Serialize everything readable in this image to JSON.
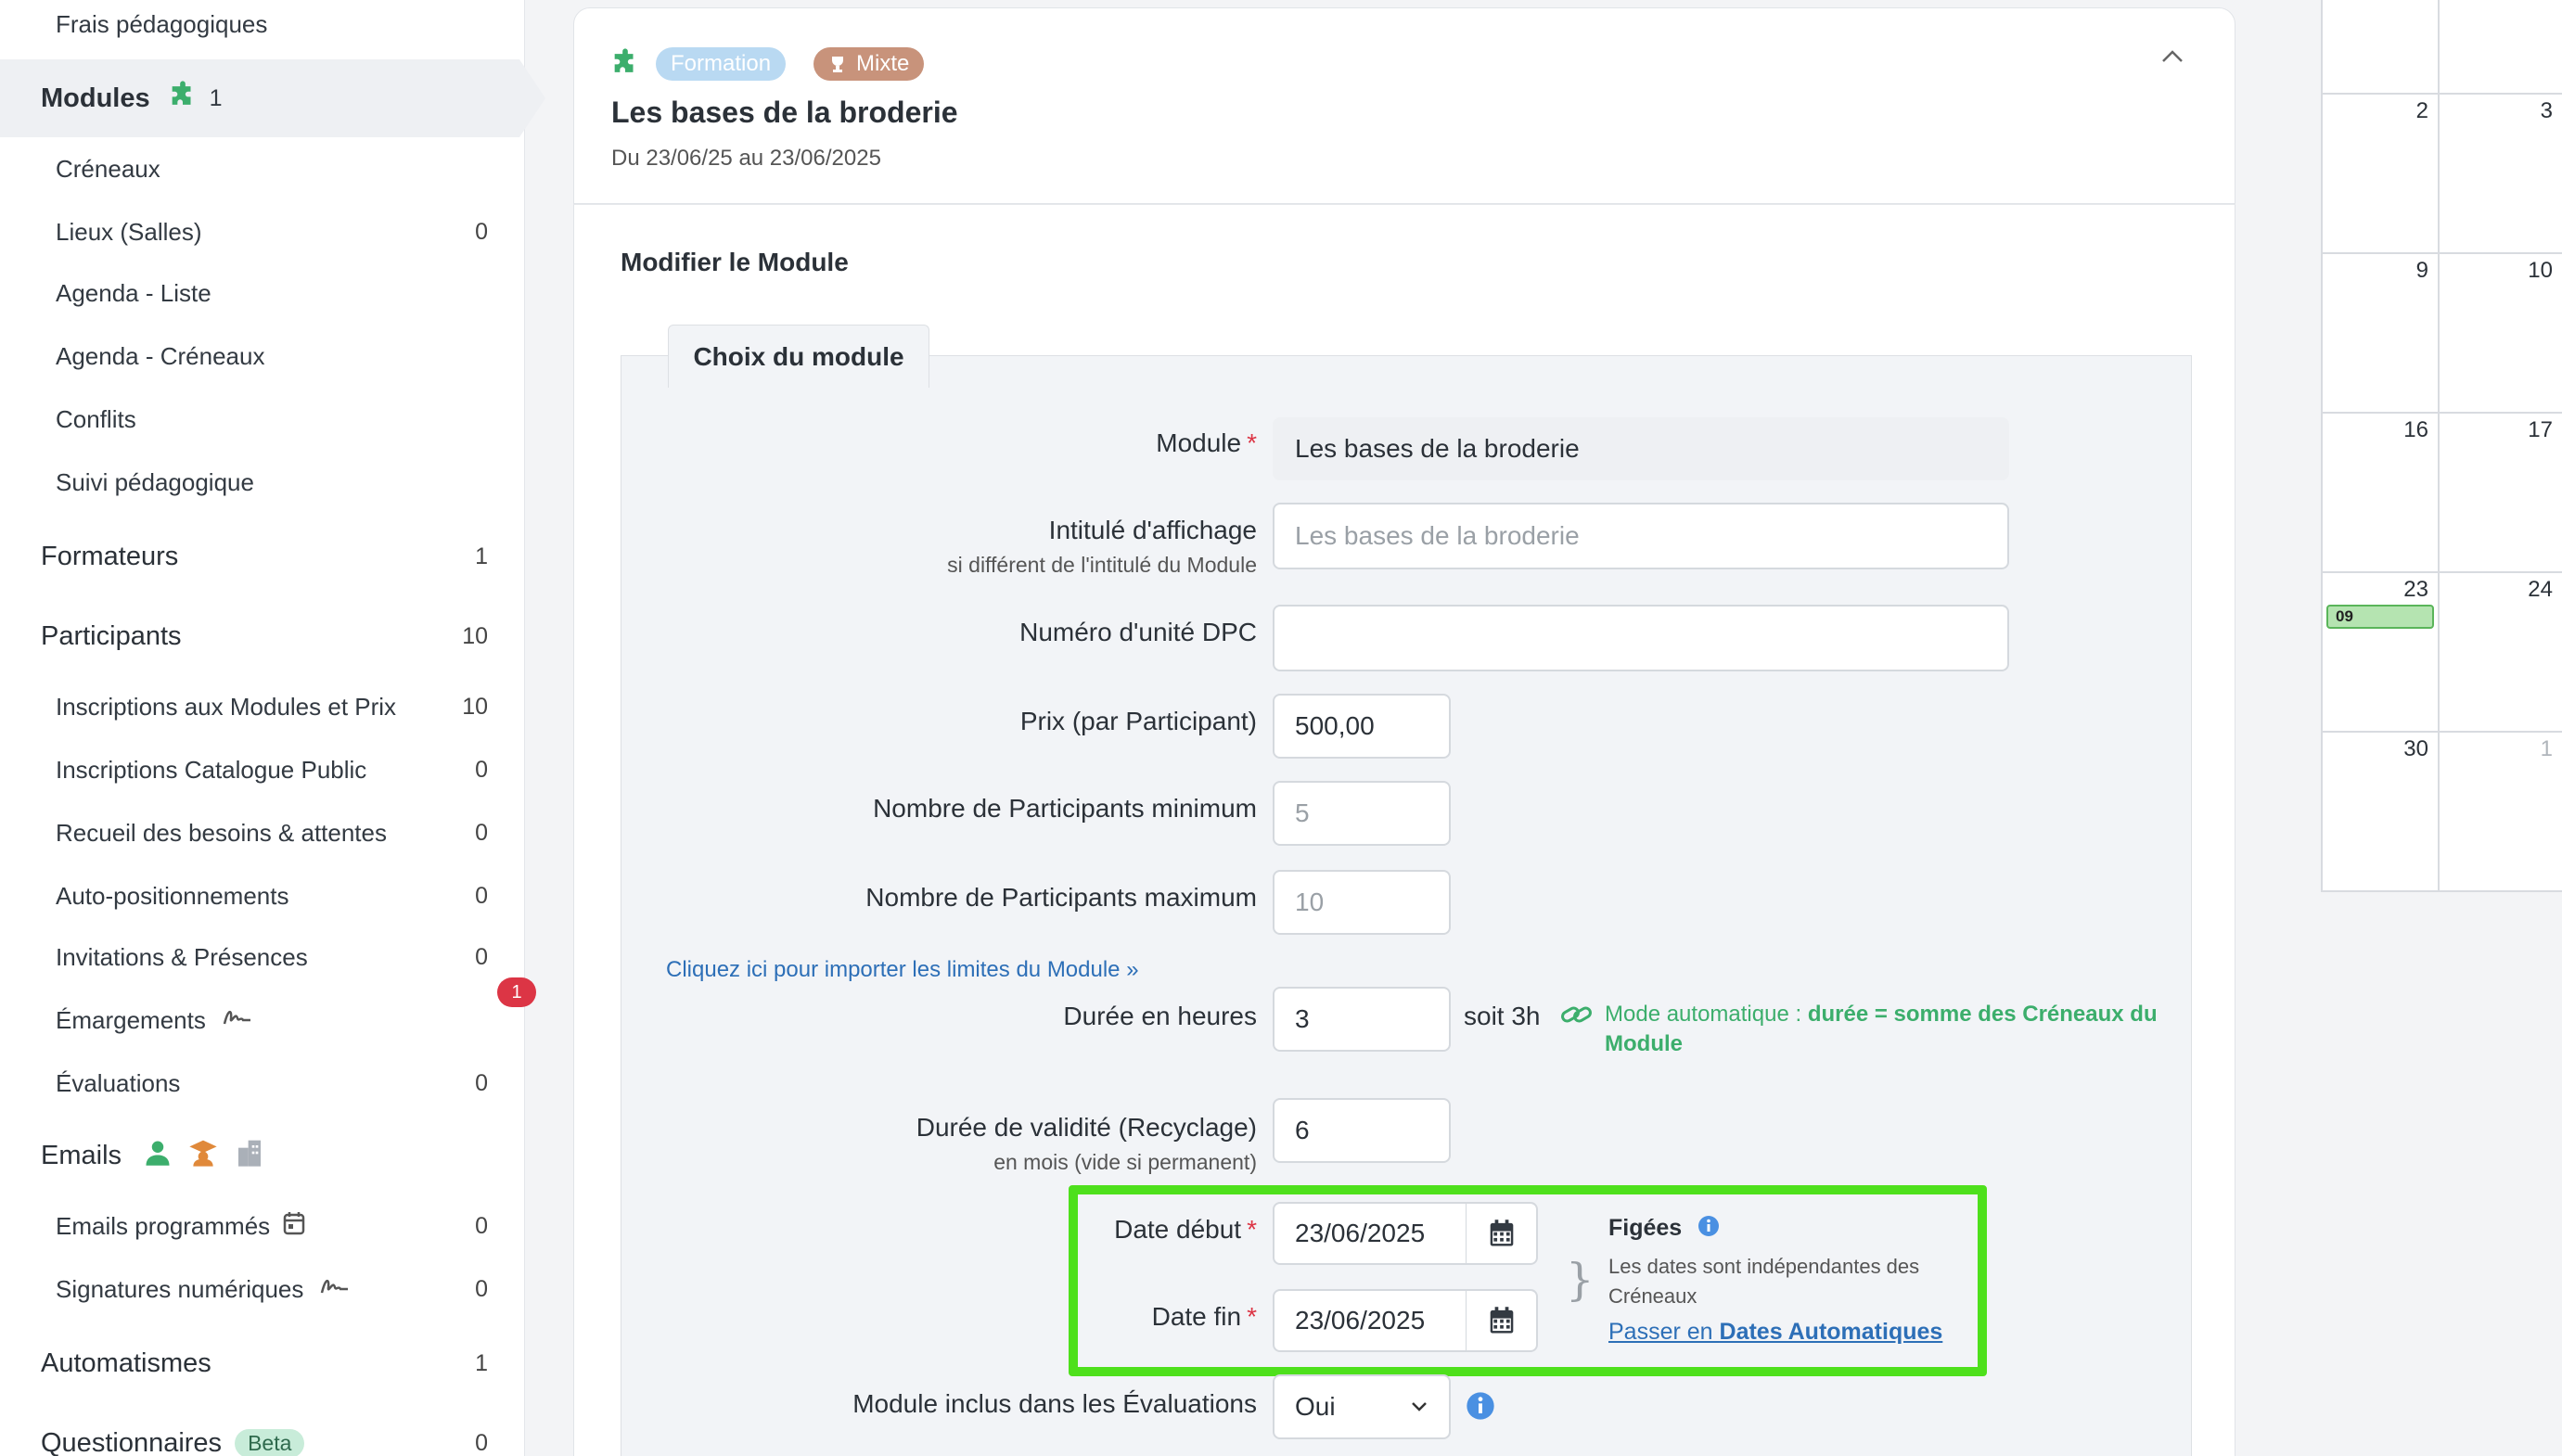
{
  "sidebar": {
    "items": [
      {
        "label": "Frais pédagogiques",
        "count": ""
      },
      {
        "label": "Modules",
        "count": "1"
      },
      {
        "label": "Créneaux",
        "count": ""
      },
      {
        "label": "Lieux (Salles)",
        "count": "0"
      },
      {
        "label": "Agenda - Liste",
        "count": ""
      },
      {
        "label": "Agenda - Créneaux",
        "count": ""
      },
      {
        "label": "Conflits",
        "count": ""
      },
      {
        "label": "Suivi pédagogique",
        "count": ""
      },
      {
        "label": "Formateurs",
        "count": "1"
      },
      {
        "label": "Participants",
        "count": "10"
      },
      {
        "label": "Inscriptions aux Modules et Prix",
        "count": "10"
      },
      {
        "label": "Inscriptions Catalogue Public",
        "count": "0"
      },
      {
        "label": "Recueil des besoins & attentes",
        "count": "0"
      },
      {
        "label": "Auto-positionnements",
        "count": "0"
      },
      {
        "label": "Invitations & Présences",
        "count": "0"
      },
      {
        "label": "Émargements",
        "count": ""
      },
      {
        "label": "Évaluations",
        "count": "0"
      },
      {
        "label": "Emails",
        "count": ""
      },
      {
        "label": "Emails programmés",
        "count": "0"
      },
      {
        "label": "Signatures numériques",
        "count": "0"
      },
      {
        "label": "Automatismes",
        "count": "1"
      },
      {
        "label": "Questionnaires",
        "count": "0",
        "badge": "Beta"
      }
    ],
    "emargements_badge": "1"
  },
  "module_card": {
    "tag_formation": "Formation",
    "tag_mixte": "Mixte",
    "title": "Les bases de la broderie",
    "dates": "Du 23/06/25 au 23/06/2025"
  },
  "form": {
    "heading": "Modifier le Module",
    "tab_label": "Choix du module",
    "module_label": "Module",
    "module_value": "Les bases de la broderie",
    "intitule_label": "Intitulé d'affichage",
    "intitule_sublabel": "si différent de l'intitulé du Module",
    "intitule_placeholder": "Les bases de la broderie",
    "dpc_label": "Numéro d'unité DPC",
    "prix_label": "Prix (par Participant)",
    "prix_value": "500,00",
    "min_label": "Nombre de Participants minimum",
    "min_placeholder": "5",
    "max_label": "Nombre de Participants maximum",
    "max_placeholder": "10",
    "import_link": "Cliquez ici pour importer les limites du Module »",
    "duree_label": "Durée en heures",
    "duree_value": "3",
    "soit": "soit 3h",
    "auto_mode_prefix": "Mode automatique : ",
    "auto_mode_bold": "durée = somme des Créneaux du Module",
    "validite_label": "Durée de validité (Recyclage)",
    "validite_sublabel": "en mois (vide si permanent)",
    "validite_value": "6",
    "date_debut_label": "Date début",
    "date_debut_value": "23/06/2025",
    "date_fin_label": "Date fin",
    "date_fin_value": "23/06/2025",
    "figees_title": "Figées",
    "figees_desc": "Les dates sont indépendantes des Créneaux",
    "passer_prefix": "Passer en ",
    "passer_link": "Dates Automatiques",
    "evaluations_label": "Module inclus dans les Évaluations",
    "evaluations_value": "Oui"
  },
  "calendar": {
    "rows": [
      [
        "",
        ""
      ],
      [
        "2",
        "3"
      ],
      [
        "9",
        "10"
      ],
      [
        "16",
        "17"
      ],
      [
        "23",
        "24"
      ],
      [
        "30",
        "1"
      ]
    ],
    "event_label": "09"
  },
  "colors": {
    "highlight": "#4ee01c",
    "accent_green": "#3cae6c",
    "link_blue": "#2d6fb7",
    "required_red": "#dc3545"
  }
}
